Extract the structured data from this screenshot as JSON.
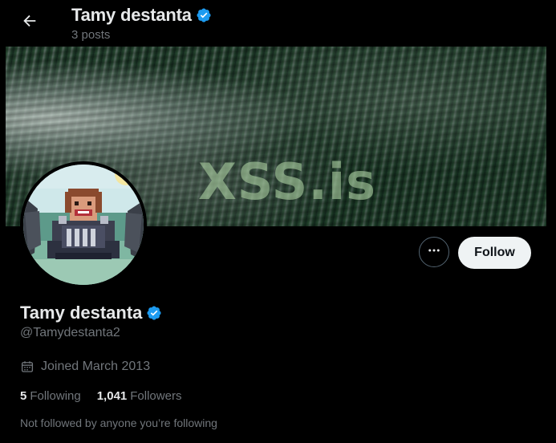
{
  "header": {
    "back_icon": "arrow-left-icon",
    "name": "Tamy destanta",
    "posts": "3 posts"
  },
  "banner": {
    "watermark": "XSS.is"
  },
  "actions": {
    "more_icon": "more-horizontal-icon",
    "follow_label": "Follow"
  },
  "profile": {
    "name": "Tamy destanta",
    "verified_icon": "verified-badge-icon",
    "handle": "@Tamydestanta2",
    "calendar_icon": "calendar-icon",
    "joined": "Joined March 2013",
    "following_count": "5",
    "following_label": "Following",
    "followers_count": "1,041",
    "followers_label": "Followers",
    "mutuals_note": "Not followed by anyone you’re following"
  },
  "colors": {
    "background": "#000000",
    "verified": "#1d9bf0",
    "primary_text": "#e7e9ea",
    "secondary_text": "#71767b",
    "follow_button_bg": "#eff3f4"
  }
}
